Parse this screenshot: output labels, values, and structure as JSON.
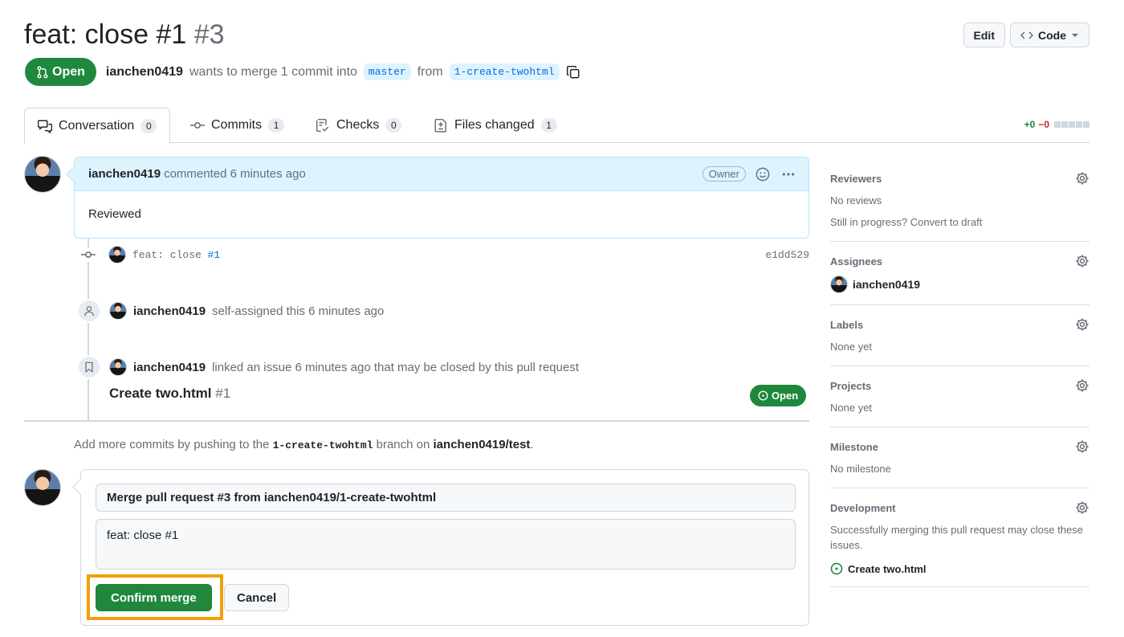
{
  "pr": {
    "title": "feat: close #1",
    "number": "#3",
    "state": "Open",
    "author": "ianchen0419",
    "merge_text_1": "wants to merge 1 commit into",
    "base_branch": "master",
    "merge_text_2": "from",
    "head_branch": "1-create-twohtml"
  },
  "header_actions": {
    "edit": "Edit",
    "code": "Code"
  },
  "tabs": [
    {
      "label": "Conversation",
      "count": "0"
    },
    {
      "label": "Commits",
      "count": "1"
    },
    {
      "label": "Checks",
      "count": "0"
    },
    {
      "label": "Files changed",
      "count": "1"
    }
  ],
  "diffstat": {
    "additions": "+0",
    "deletions": "−0"
  },
  "comment": {
    "author": "ianchen0419",
    "action": "commented 6 minutes ago",
    "role": "Owner",
    "body": "Reviewed"
  },
  "commit": {
    "message_prefix": "feat: close ",
    "issue_ref": "#1",
    "sha": "e1dd529"
  },
  "assign_event": {
    "user": "ianchen0419",
    "text": "self-assigned this 6 minutes ago"
  },
  "link_event": {
    "user": "ianchen0419",
    "text": "linked an issue 6 minutes ago that may be closed by this pull request",
    "issue_title": "Create two.html",
    "issue_number": "#1",
    "issue_state": "Open"
  },
  "push_hint": {
    "prefix": "Add more commits by pushing to the",
    "branch": "1-create-twohtml",
    "middle": "branch on",
    "repo": "ianchen0419/test",
    "suffix": "."
  },
  "merge_form": {
    "title_value": "Merge pull request #3 from ianchen0419/1-create-twohtml",
    "message_value": "feat: close #1",
    "confirm_label": "Confirm merge",
    "cancel_label": "Cancel",
    "highlight_color": "#f59e0b"
  },
  "sidebar": {
    "reviewers": {
      "label": "Reviewers",
      "value": "No reviews",
      "hint": "Still in progress? Convert to draft"
    },
    "assignees": {
      "label": "Assignees",
      "user": "ianchen0419"
    },
    "labels": {
      "label": "Labels",
      "value": "None yet"
    },
    "projects": {
      "label": "Projects",
      "value": "None yet"
    },
    "milestone": {
      "label": "Milestone",
      "value": "No milestone"
    },
    "development": {
      "label": "Development",
      "text": "Successfully merging this pull request may close these issues.",
      "issue": "Create two.html"
    }
  },
  "colors": {
    "open_green": "#1f883d",
    "link_blue": "#0969da",
    "deletions_red": "#cf222e"
  }
}
